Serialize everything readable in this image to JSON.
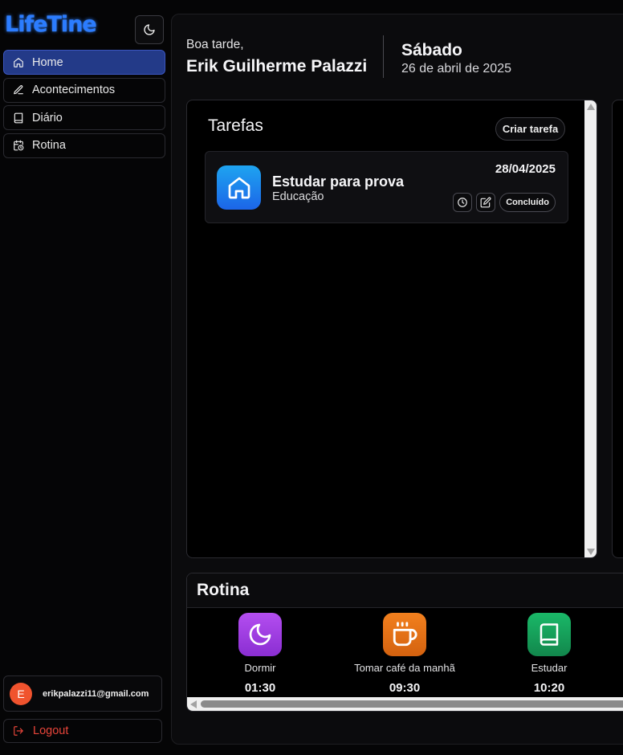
{
  "app": {
    "logo": "LifeTine"
  },
  "sidebar": {
    "items": [
      {
        "label": "Home",
        "icon": "home-icon",
        "active": true
      },
      {
        "label": "Acontecimentos",
        "icon": "pencil-icon"
      },
      {
        "label": "Diário",
        "icon": "book-icon"
      },
      {
        "label": "Rotina",
        "icon": "calendar-clock-icon"
      }
    ],
    "user": {
      "avatar_letter": "E",
      "email": "erikpalazzi11@gmail.com",
      "avatar_color": "#f0532e"
    },
    "logout_label": "Logout"
  },
  "header": {
    "greeting": "Boa tarde,",
    "user_name": "Erik Guilherme Palazzi",
    "weekday": "Sábado",
    "date": "26 de abril de 2025"
  },
  "tasks": {
    "title": "Tarefas",
    "create_label": "Criar tarefa",
    "items": [
      {
        "name": "Estudar para prova",
        "category": "Educação",
        "date": "28/04/2025",
        "icon": "home-icon",
        "status_label": "Concluído"
      }
    ]
  },
  "routine": {
    "title": "Rotina",
    "items": [
      {
        "name": "Dormir",
        "time": "01:30",
        "icon": "moon-icon",
        "color": "#9b3ee0"
      },
      {
        "name": "Tomar café da manhã",
        "time": "09:30",
        "icon": "coffee-icon",
        "color": "#e56f16"
      },
      {
        "name": "Estudar",
        "time": "10:20",
        "icon": "book-icon",
        "color": "#15a05a"
      }
    ]
  },
  "colors": {
    "accent": "#233a88",
    "logo": "#2b7cff",
    "logout": "#e8453a"
  }
}
